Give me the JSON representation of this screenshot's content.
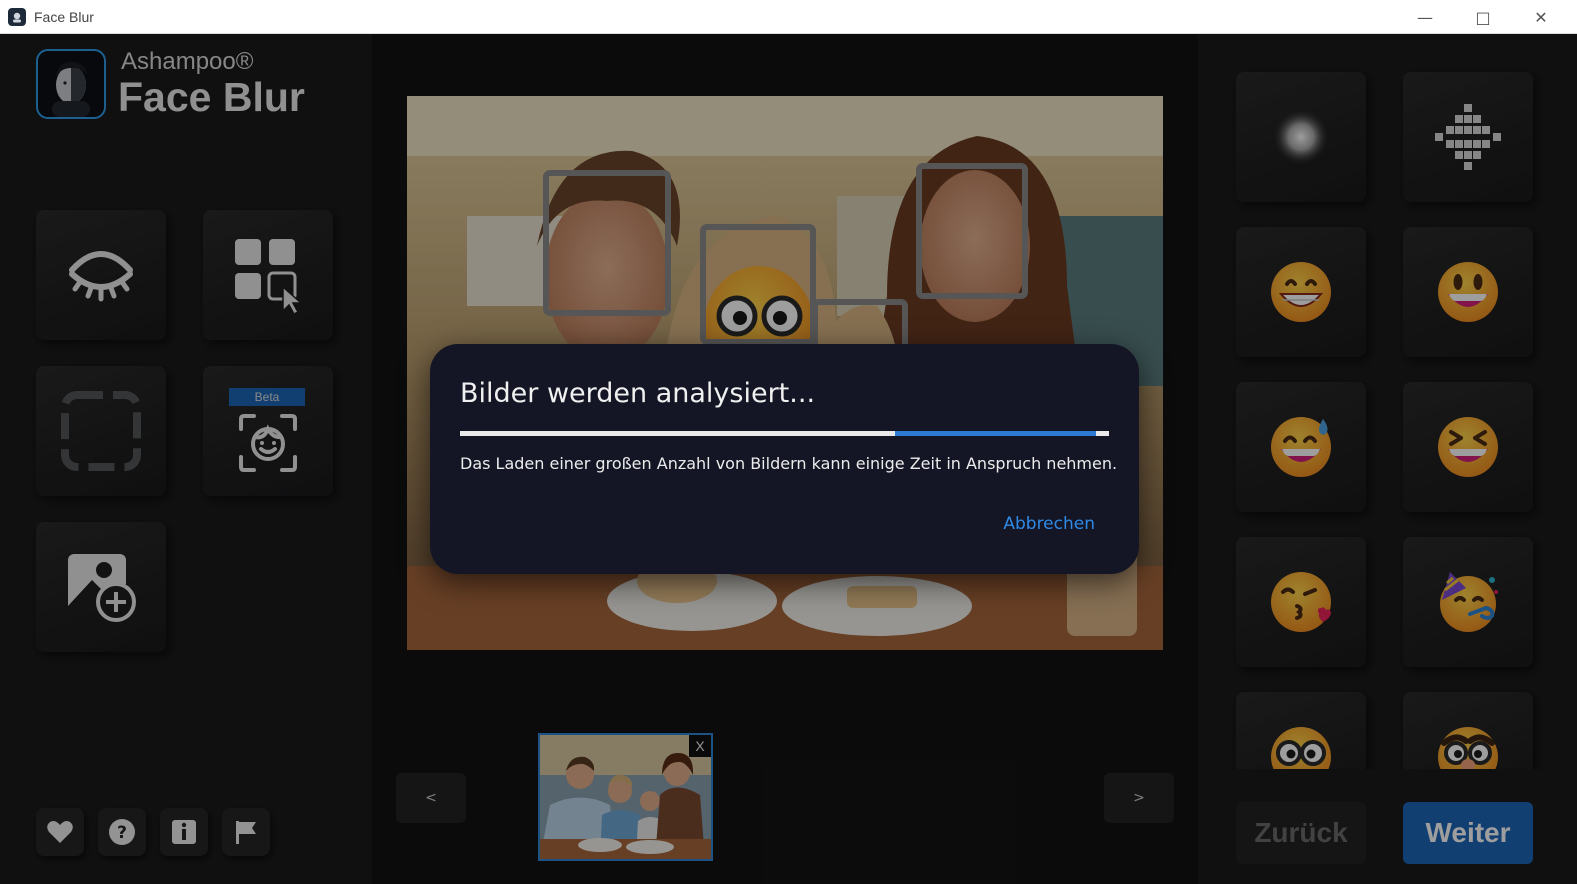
{
  "window": {
    "title": "Face Blur",
    "minimize": "—",
    "maximize": "□",
    "close": "✕"
  },
  "brand": {
    "vendor": "Ashampoo®",
    "product": "Face Blur"
  },
  "sidebar": {
    "tools": [
      {
        "icon": "eye-closed-icon"
      },
      {
        "icon": "grid-select-icon"
      },
      {
        "icon": "dashed-rectangle-icon"
      },
      {
        "icon": "face-detect-icon",
        "badge": "Beta"
      },
      {
        "icon": "add-image-icon"
      }
    ],
    "bottom_buttons": [
      {
        "icon": "heart-icon"
      },
      {
        "icon": "help-icon"
      },
      {
        "icon": "info-icon"
      },
      {
        "icon": "flag-icon"
      }
    ]
  },
  "gallery": {
    "prev_label": "<",
    "next_label": ">",
    "thumb_remove": "X"
  },
  "effects": [
    {
      "icon": "blur-icon"
    },
    {
      "icon": "pixelate-icon"
    },
    {
      "icon": "grinning-emoji-icon"
    },
    {
      "icon": "grinning-big-eyes-emoji-icon"
    },
    {
      "icon": "sweat-smile-emoji-icon"
    },
    {
      "icon": "squinting-laugh-emoji-icon"
    },
    {
      "icon": "kissing-emoji-icon"
    },
    {
      "icon": "partying-emoji-icon"
    },
    {
      "icon": "nerd-emoji-icon"
    },
    {
      "icon": "disguise-emoji-icon"
    }
  ],
  "footer": {
    "back_label": "Zurück",
    "next_label": "Weiter"
  },
  "dialog": {
    "title": "Bilder werden analysiert...",
    "message": "Das Laden einer großen Anzahl von Bildern kann einige Zeit in Anspruch nehmen.",
    "cancel_label": "Abbrechen",
    "progress_segment": [
      0.67,
      0.98
    ]
  },
  "colors": {
    "accent": "#2f8ae6",
    "primary_button": "#1e66b8",
    "emoji_yellow": "#f6b52f"
  }
}
